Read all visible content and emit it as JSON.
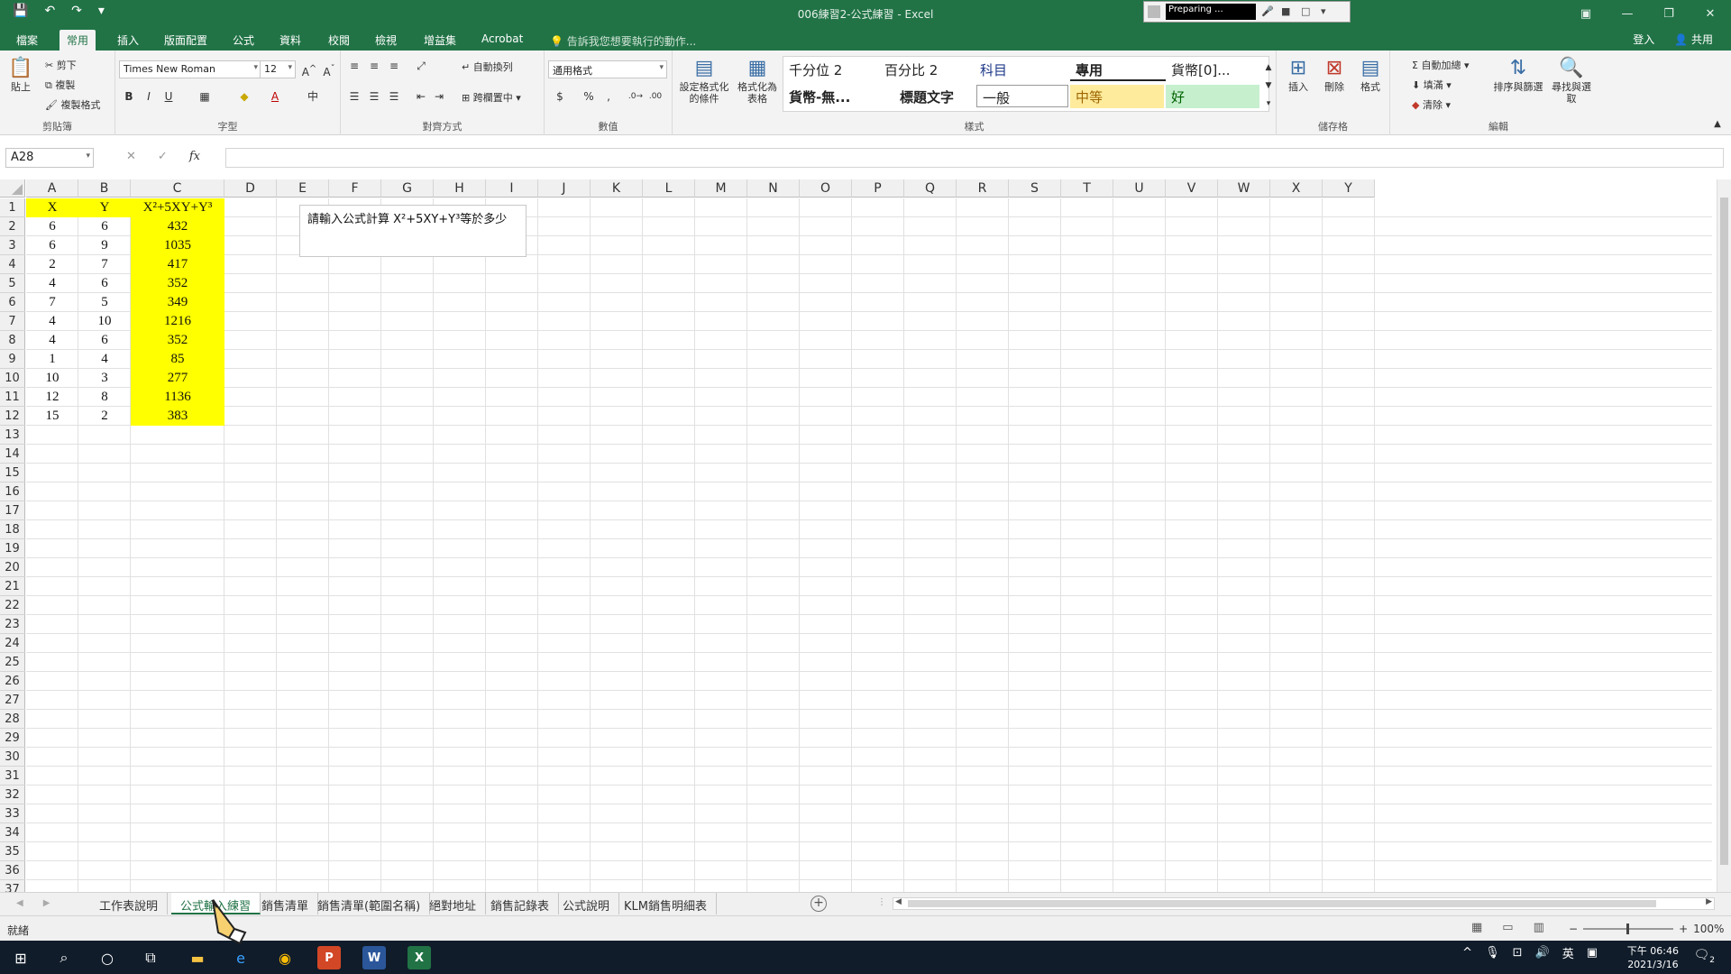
{
  "window": {
    "title": "006練習2-公式練習 - Excel",
    "recording_status": "Preparing ...",
    "sign_in": "登入",
    "share": "共用"
  },
  "tabs": [
    "檔案",
    "常用",
    "插入",
    "版面配置",
    "公式",
    "資料",
    "校閱",
    "檢視",
    "增益集",
    "Acrobat"
  ],
  "active_tab": "常用",
  "tell_me": "告訴我您想要執行的動作...",
  "ribbon": {
    "clipboard": {
      "paste": "貼上",
      "cut": "剪下",
      "copy": "複製",
      "format_painter": "複製格式",
      "label": "剪貼簿"
    },
    "font": {
      "name": "Times New Roman",
      "size": "12",
      "label": "字型",
      "bold": "B",
      "italic": "I",
      "underline": "U"
    },
    "alignment": {
      "wrap": "自動換列",
      "merge": "跨欄置中",
      "label": "對齊方式"
    },
    "number": {
      "format": "通用格式",
      "currency": "$",
      "percent": "%",
      "comma": ",",
      "label": "數值"
    },
    "styles": {
      "conditional": "設定格式化的條件",
      "as_table": "格式化為表格",
      "cells": [
        {
          "text": "千分位 2",
          "color": "#222222",
          "bg": ""
        },
        {
          "text": "百分比 2",
          "color": "#222222",
          "bg": ""
        },
        {
          "text": "科目",
          "color": "#1f3a8a",
          "bg": ""
        },
        {
          "text": "專用",
          "color": "#222222",
          "bg": ""
        },
        {
          "text": "貨幣[0]...",
          "color": "#222222",
          "bg": ""
        },
        {
          "text": "貨幣-無...",
          "color": "#222222",
          "bg": ""
        },
        {
          "text": "標題文字",
          "color": "#222222",
          "bg": ""
        },
        {
          "text": "一般",
          "color": "#222222",
          "bg": "#ffffff"
        },
        {
          "text": "中等",
          "color": "#9c6500",
          "bg": "#ffeb9c"
        },
        {
          "text": "好",
          "color": "#006100",
          "bg": "#c6efce"
        }
      ],
      "label": "樣式"
    },
    "cells_group": {
      "insert": "插入",
      "delete": "刪除",
      "format": "格式",
      "label": "儲存格"
    },
    "editing": {
      "autosum": "自動加總",
      "fill": "填滿",
      "clear": "清除",
      "sort": "排序與篩選",
      "find": "尋找與選取",
      "label": "編輯"
    }
  },
  "formula_bar": {
    "name_box": "A28",
    "formula": ""
  },
  "columns": [
    "A",
    "B",
    "C",
    "D",
    "E",
    "F",
    "G",
    "H",
    "I",
    "J",
    "K",
    "L",
    "M",
    "N",
    "O",
    "P",
    "Q",
    "R",
    "S",
    "T",
    "U",
    "V",
    "W",
    "X",
    "Y"
  ],
  "rows": [
    "1",
    "2",
    "3",
    "4",
    "5",
    "6",
    "7",
    "8",
    "9",
    "10",
    "11",
    "12",
    "13",
    "14",
    "15",
    "16",
    "17",
    "18",
    "19",
    "20",
    "21",
    "22",
    "23",
    "24",
    "25",
    "26",
    "27",
    "28",
    "29",
    "30",
    "31",
    "32",
    "33",
    "34",
    "35",
    "36",
    "37"
  ],
  "table": {
    "header": [
      "X",
      "Y",
      "X²+5XY+Y³"
    ],
    "data": [
      [
        "6",
        "6",
        "432"
      ],
      [
        "6",
        "9",
        "1035"
      ],
      [
        "2",
        "7",
        "417"
      ],
      [
        "4",
        "6",
        "352"
      ],
      [
        "7",
        "5",
        "349"
      ],
      [
        "4",
        "10",
        "1216"
      ],
      [
        "4",
        "6",
        "352"
      ],
      [
        "1",
        "4",
        "85"
      ],
      [
        "10",
        "3",
        "277"
      ],
      [
        "12",
        "8",
        "1136"
      ],
      [
        "15",
        "2",
        "383"
      ]
    ],
    "highlight_color": "#ffff00"
  },
  "note": "請輸入公式計算 X²+5XY+Y³等於多少",
  "sheets": [
    "工作表說明",
    "公式輸入練習",
    "銷售清單",
    "銷售清單(範圍名稱)",
    "絕對地址",
    "銷售記錄表",
    "公式說明",
    "KLM銷售明細表"
  ],
  "active_sheet": "公式輸入練習",
  "status": {
    "ready": "就緒",
    "zoom": "100%"
  },
  "taskbar": {
    "apps": [
      "windows-start",
      "search",
      "cortana",
      "task-view",
      "file-explorer",
      "edge",
      "chrome",
      "powerpoint",
      "word",
      "excel"
    ],
    "ime": "英",
    "time": "下午 06:46",
    "date": "2021/3/16",
    "notifications": "2"
  }
}
